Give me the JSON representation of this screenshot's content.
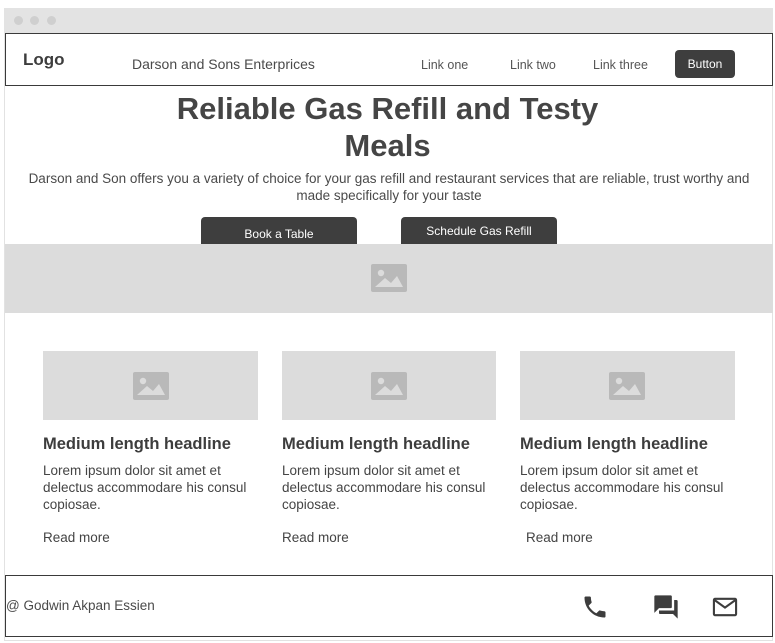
{
  "navbar": {
    "logo": "Logo",
    "company": "Darson and Sons Enterprices",
    "links": [
      "Link one",
      "Link two",
      "Link three"
    ],
    "button": "Button"
  },
  "hero": {
    "title": "Reliable Gas Refill and Testy Meals",
    "subtitle": "Darson and Son offers you a variety of choice for your gas refill and restaurant services that are reliable, trust worthy and made specifically for your taste",
    "buttons": [
      "Book a Table",
      "Schedule Gas Refill"
    ]
  },
  "cards": [
    {
      "headline": "Medium length headline",
      "body": "Lorem ipsum dolor sit amet et delectus accommodare his consul copiosae.",
      "link": "Read more"
    },
    {
      "headline": "Medium length headline",
      "body": "Lorem ipsum dolor sit amet et delectus accommodare his consul copiosae.",
      "link": "Read more"
    },
    {
      "headline": "Medium length headline",
      "body": "Lorem ipsum dolor sit amet et delectus accommodare his consul copiosae.",
      "link": "Read more"
    }
  ],
  "footer": {
    "credit": "@ Godwin Akpan Essien",
    "icons": [
      "phone-icon",
      "chat-icon",
      "mail-icon"
    ]
  },
  "colors": {
    "dark": "#3e3e3e",
    "placeholder": "#dcdcdc",
    "text": "#3d3d3d"
  }
}
